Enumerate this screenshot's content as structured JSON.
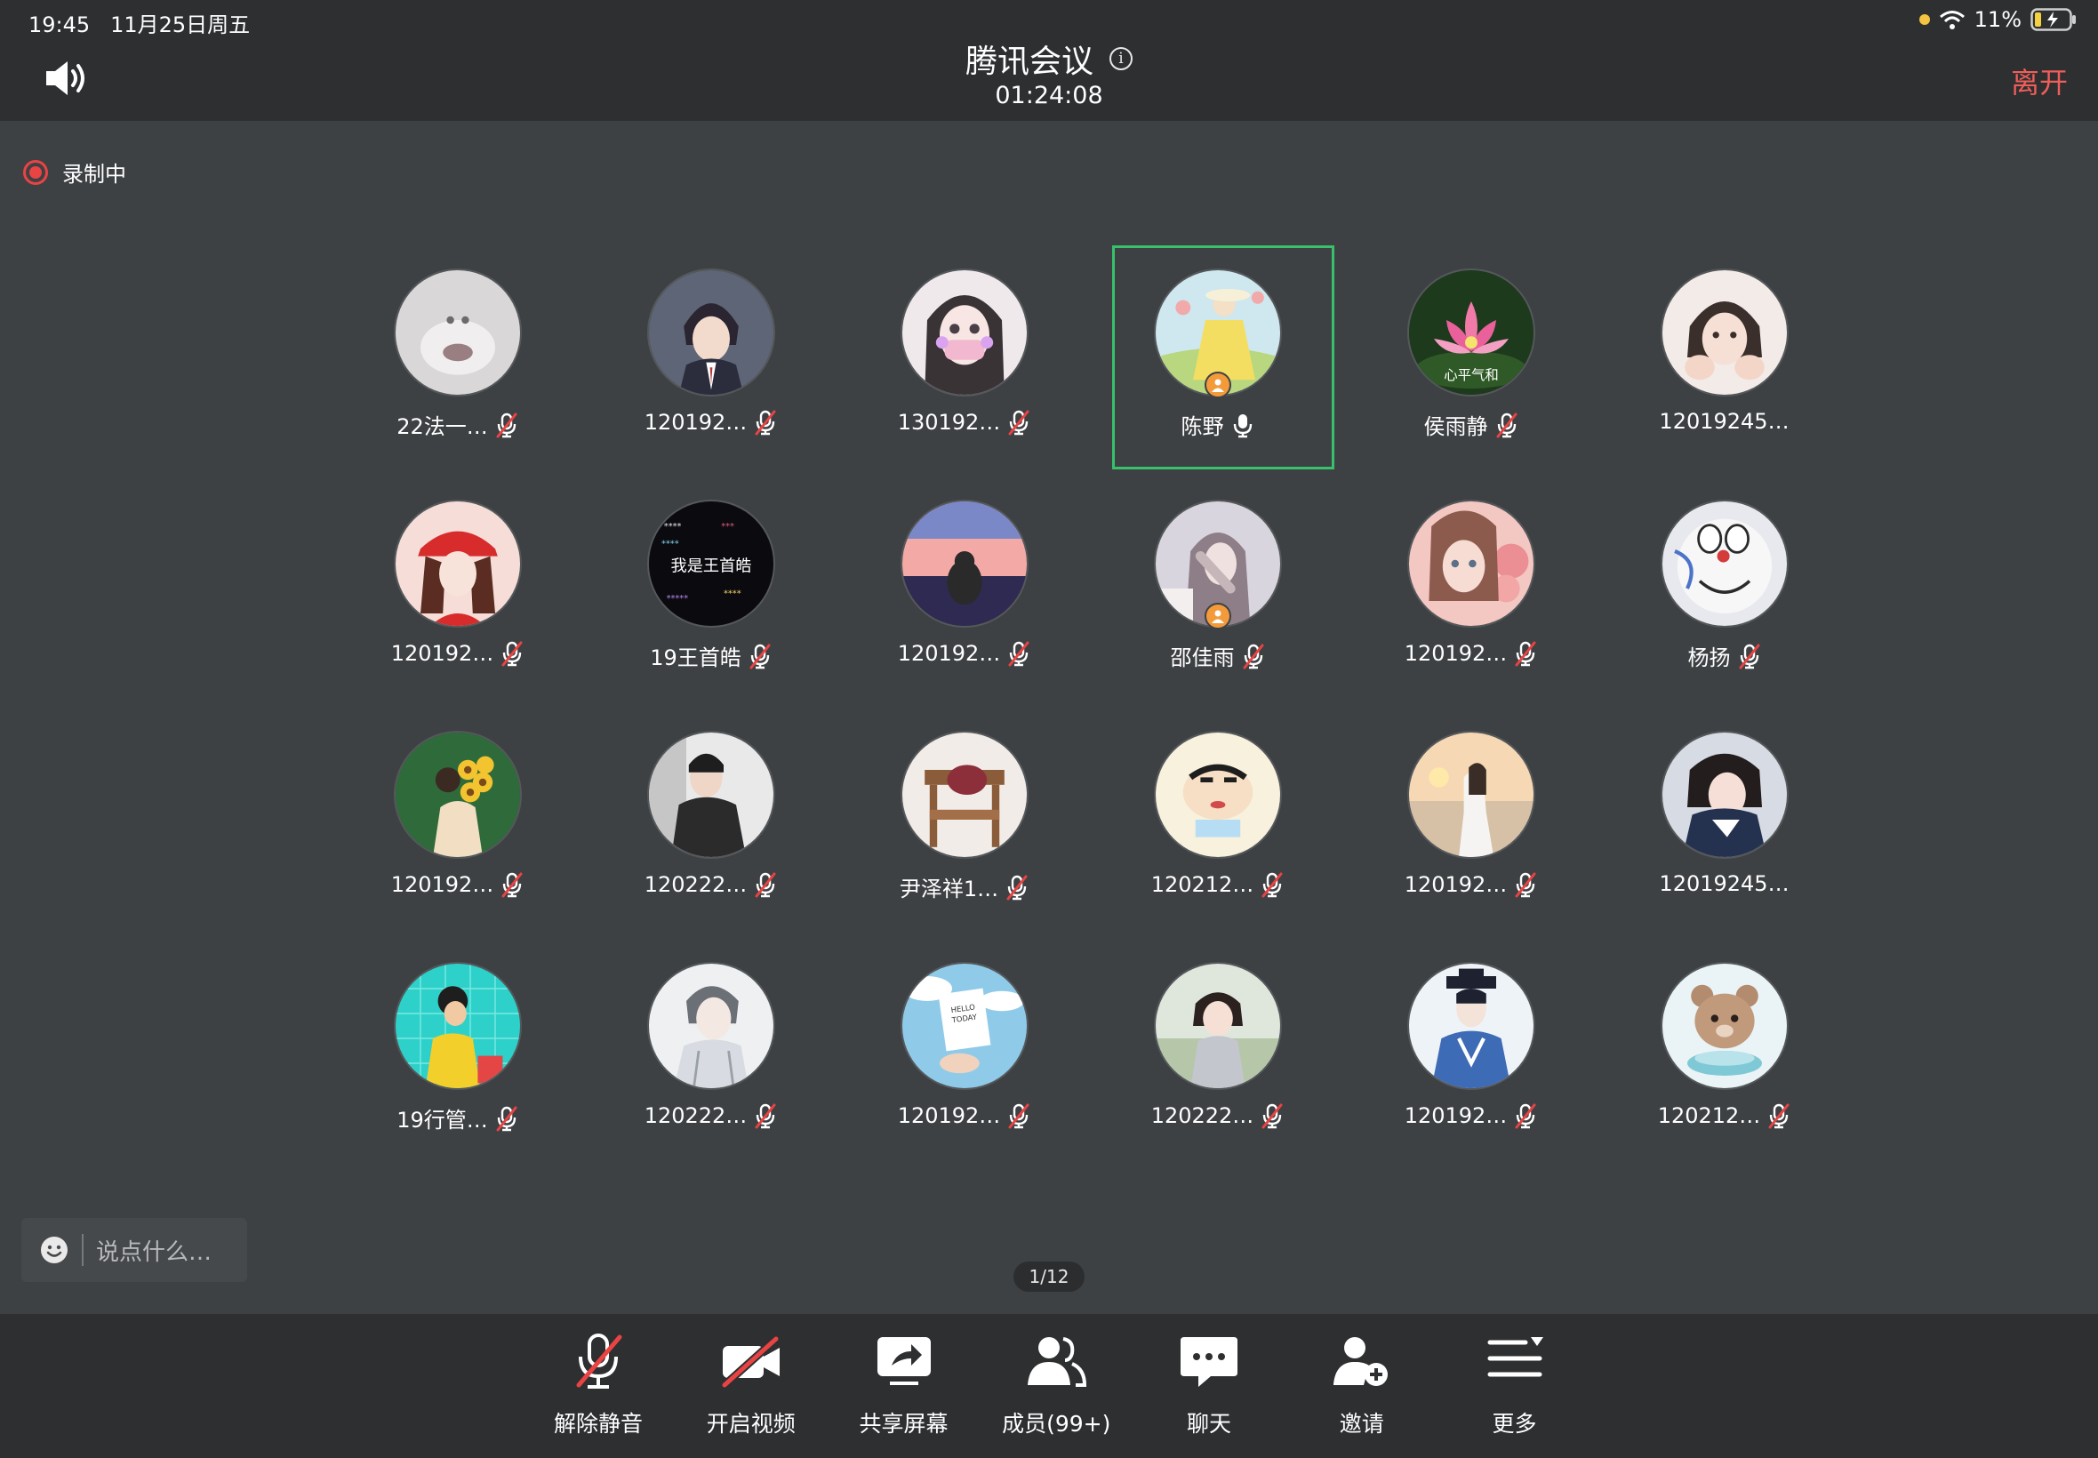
{
  "status_bar": {
    "time": "19:45",
    "date": "11月25日周五",
    "battery": "11%"
  },
  "header": {
    "title": "腾讯会议",
    "timer": "01:24:08",
    "leave_label": "离开"
  },
  "recording_label": "录制中",
  "participants": [
    {
      "name": "22法一…",
      "avatar": "cat-closeup",
      "mic": "muted"
    },
    {
      "name": "120192…",
      "avatar": "anime-boy-suit",
      "mic": "muted"
    },
    {
      "name": "130192…",
      "avatar": "anime-girl-mask",
      "mic": "muted"
    },
    {
      "name": "陈野",
      "avatar": "yellow-dress-illustration",
      "mic": "on",
      "host": true,
      "active": true
    },
    {
      "name": "侯雨静",
      "avatar": "lotus-flower",
      "mic": "muted",
      "avatar_text": "心平气和"
    },
    {
      "name": "12019245…",
      "avatar": "girl-hands-face",
      "mic": "none"
    },
    {
      "name": "120192…",
      "avatar": "girl-red-hat",
      "mic": "muted"
    },
    {
      "name": "19王首皓",
      "avatar": "text-collage",
      "mic": "muted",
      "avatar_text": "我是王首皓"
    },
    {
      "name": "120192…",
      "avatar": "sunset-girl",
      "mic": "muted"
    },
    {
      "name": "邵佳雨",
      "avatar": "girl-in-car",
      "mic": "muted",
      "host": true
    },
    {
      "name": "120192…",
      "avatar": "girl-roses",
      "mic": "muted"
    },
    {
      "name": "杨扬",
      "avatar": "doraemon",
      "mic": "muted"
    },
    {
      "name": "120192…",
      "avatar": "sunflower-bouquet",
      "mic": "muted"
    },
    {
      "name": "120222…",
      "avatar": "dark-jacket-boy",
      "mic": "muted"
    },
    {
      "name": "尹泽祥1…",
      "avatar": "wooden-chair",
      "mic": "muted"
    },
    {
      "name": "120212…",
      "avatar": "shin-chan",
      "mic": "muted"
    },
    {
      "name": "120192…",
      "avatar": "beach-girl",
      "mic": "muted"
    },
    {
      "name": "12019245…",
      "avatar": "girl-jacket",
      "mic": "none"
    },
    {
      "name": "19行管…",
      "avatar": "cartoon-boy-yellow",
      "mic": "muted"
    },
    {
      "name": "120222…",
      "avatar": "anime-boy-sketch",
      "mic": "muted"
    },
    {
      "name": "120192…",
      "avatar": "hello-today-card",
      "mic": "muted",
      "avatar_text": "HELLO TODAY"
    },
    {
      "name": "120222…",
      "avatar": "little-girl",
      "mic": "muted"
    },
    {
      "name": "120192…",
      "avatar": "ancient-costume-boy",
      "mic": "muted"
    },
    {
      "name": "120212…",
      "avatar": "brown-bear",
      "mic": "muted"
    }
  ],
  "chat": {
    "placeholder": "说点什么…"
  },
  "pagination": "1/12",
  "toolbar": [
    {
      "key": "unmute",
      "label": "解除静音",
      "icon": "mic-off-icon"
    },
    {
      "key": "video",
      "label": "开启视频",
      "icon": "camera-off-icon"
    },
    {
      "key": "share",
      "label": "共享屏幕",
      "icon": "share-screen-icon"
    },
    {
      "key": "members",
      "label": "成员(99+)",
      "icon": "members-icon"
    },
    {
      "key": "chat",
      "label": "聊天",
      "icon": "chat-icon"
    },
    {
      "key": "invite",
      "label": "邀请",
      "icon": "invite-icon"
    },
    {
      "key": "more",
      "label": "更多",
      "icon": "more-icon"
    }
  ],
  "colors": {
    "background": "#3e4144",
    "bar": "#2d2f31",
    "leave": "#ef5e5a",
    "active_border": "#38c06b",
    "recording": "#e94343",
    "host_badge": "#f39a3b"
  }
}
